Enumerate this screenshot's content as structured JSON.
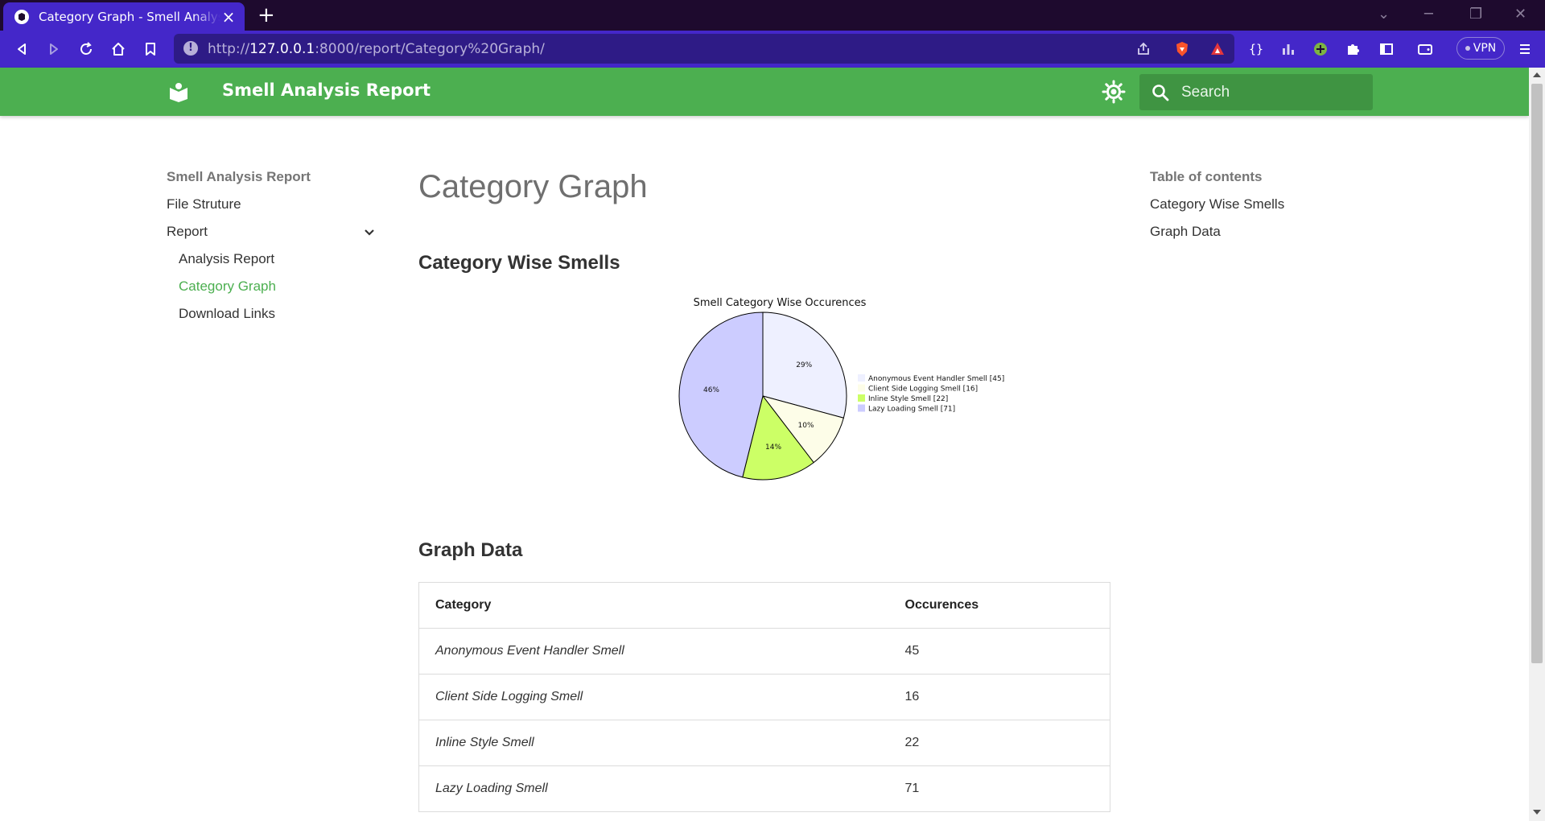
{
  "browser": {
    "tab_title": "Category Graph - Smell Analysis Report",
    "url_scheme": "http://",
    "url_host": "127.0.0.1",
    "url_rest": ":8000/report/Category%20Graph/",
    "vpn_label": "VPN",
    "tab_bg": "#4427c9",
    "chrome_bg": "#1e0a2e"
  },
  "header": {
    "title": "Smell Analysis Report",
    "search_placeholder": "Search",
    "brand_color": "#4caf50"
  },
  "nav": {
    "title": "Smell Analysis Report",
    "items": [
      {
        "label": "File Struture"
      },
      {
        "label": "Report"
      }
    ],
    "subitems": [
      {
        "label": "Analysis Report"
      },
      {
        "label": "Category Graph",
        "active": true
      },
      {
        "label": "Download Links"
      }
    ]
  },
  "toc": {
    "title": "Table of contents",
    "items": [
      {
        "label": "Category Wise Smells"
      },
      {
        "label": "Graph Data"
      }
    ]
  },
  "main": {
    "page_title": "Category Graph",
    "section1": "Category Wise Smells",
    "section2": "Graph Data"
  },
  "chart_data": {
    "type": "pie",
    "title": "Smell Category Wise Occurences",
    "categories": [
      "Anonymous Event Handler Smell",
      "Client Side Logging Smell",
      "Inline Style Smell",
      "Lazy Loading Smell"
    ],
    "values": [
      45,
      16,
      22,
      71
    ],
    "legend": [
      "Anonymous Event Handler Smell [45]",
      "Client Side Logging Smell [16]",
      "Inline Style Smell [22]",
      "Lazy Loading Smell [71]"
    ],
    "slice_labels": [
      "29%",
      "10%",
      "14%",
      "46%"
    ],
    "colors": [
      "#eef0ff",
      "#fdfde8",
      "#ccff66",
      "#ccccff"
    ],
    "legend_placement": "right"
  },
  "table": {
    "headers": [
      "Category",
      "Occurences"
    ],
    "rows": [
      {
        "category": "Anonymous Event Handler Smell",
        "count": "45"
      },
      {
        "category": "Client Side Logging Smell",
        "count": "16"
      },
      {
        "category": "Inline Style Smell",
        "count": "22"
      },
      {
        "category": "Lazy Loading Smell",
        "count": "71"
      }
    ]
  }
}
